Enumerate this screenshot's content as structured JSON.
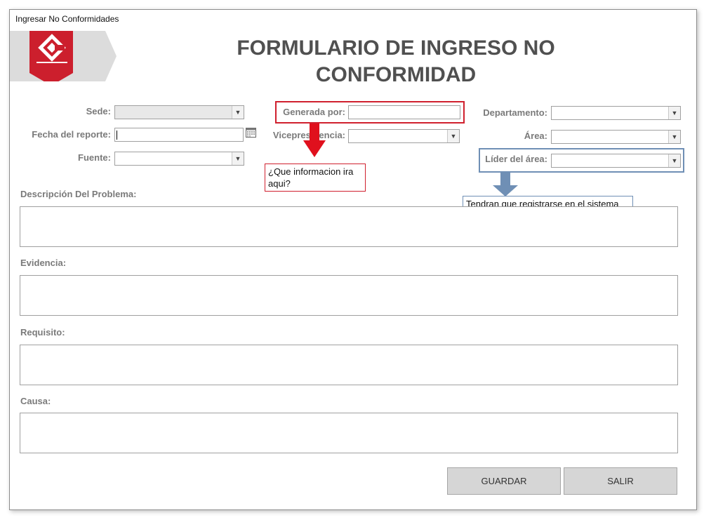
{
  "window": {
    "title": "Ingresar No Conformidades"
  },
  "header": {
    "title_line1": "FORMULARIO DE INGRESO NO",
    "title_line2": "CONFORMIDAD"
  },
  "form": {
    "sede_label": "Sede:",
    "fecha_label": "Fecha del reporte:",
    "fuente_label": "Fuente:",
    "generada_label": "Generada por:",
    "vicepresidencia_label": "Vicepresidencia:",
    "departamento_label": "Departamento:",
    "area_label": "Área:",
    "lider_label": "Líder del área:",
    "descripcion_label": "Descripción Del Problema:",
    "evidencia_label": "Evidencia:",
    "requisito_label": "Requisito:",
    "causa_label": "Causa:"
  },
  "buttons": {
    "guardar": "GUARDAR",
    "salir": "SALIR"
  },
  "annotations": {
    "red_note": "¿Que informacion ira aqui?",
    "blue_note": "Tendran que registrarse en el sistema",
    "red_color": "#d0202e",
    "blue_color": "#6f8fb5"
  },
  "logo": {
    "icon": "company-logo"
  }
}
